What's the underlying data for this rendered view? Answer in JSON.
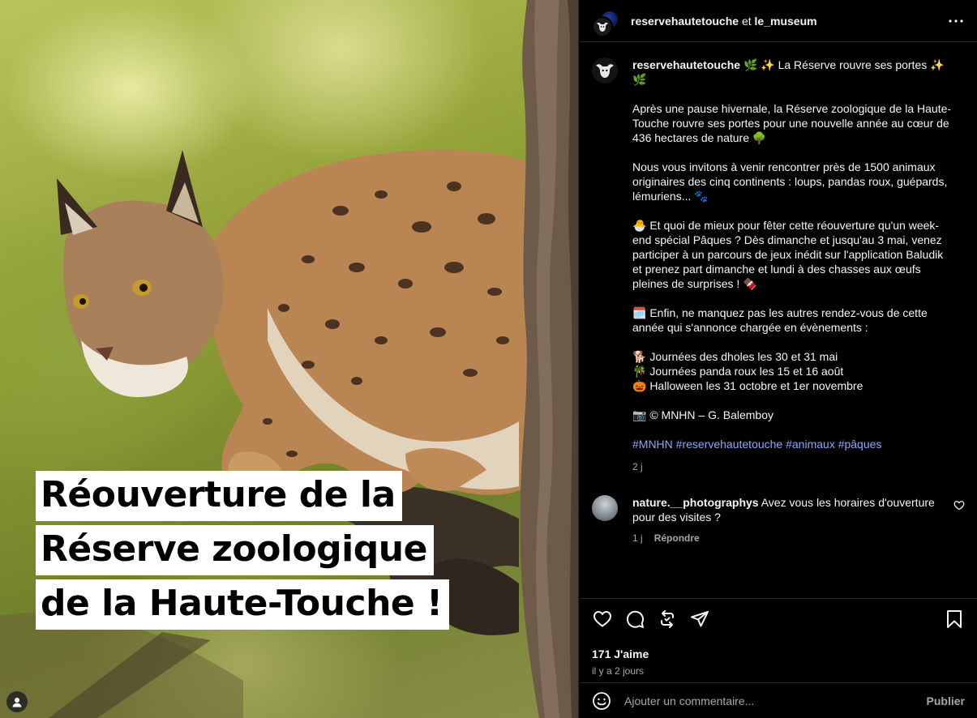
{
  "photo": {
    "caption_lines": [
      "Réouverture de la",
      "Réserve zoologique",
      "de la Haute-Touche !"
    ]
  },
  "header": {
    "account1": "reservehautetouche",
    "connector": "et",
    "account2": "le_museum"
  },
  "post": {
    "username": "reservehautetouche",
    "line0": "🌿 ✨ La Réserve rouvre ses portes ✨ 🌿",
    "para1": "Après une pause hivernale, la Réserve zoologique de la Haute-Touche rouvre ses portes pour une nouvelle année au cœur de 436 hectares de nature 🌳",
    "para2": "Nous vous invitons à venir rencontrer près de 1500 animaux originaires des cinq continents : loups, pandas roux, guépards, lémuriens... 🐾",
    "para3": "🐣 Et quoi de mieux pour fêter cette réouverture qu'un week-end spécial Pâques ? Dès dimanche et jusqu'au 3 mai, venez participer à un parcours de jeux inédit sur l'application Baludik et prenez part dimanche et lundi à des chasses aux œufs pleines de surprises ! 🍫",
    "para4": "🗓️ Enfin, ne manquez pas les autres rendez-vous de cette année qui s'annonce chargée en évènements :",
    "events": [
      "🐕 Journées des dholes les 30 et 31 mai",
      "🎋 Journées panda roux les 15 et 16 août",
      "🎃 Halloween les 31 octobre et 1er novembre"
    ],
    "credit": "📷 © MNHN – G. Balemboy",
    "hashtags": [
      "#MNHN",
      "#reservehautetouche",
      "#animaux",
      "#pâques"
    ],
    "time": "2 j"
  },
  "comment": {
    "username": "nature.__photographys",
    "text": "Avez vous les horaires d'ouverture pour des visites ?",
    "time": "1 j",
    "reply_label": "Répondre"
  },
  "actions": {
    "likes": "171 J'aime",
    "ago": "il y a 2 jours",
    "icons": [
      "heart-icon",
      "comment-icon",
      "repost-icon",
      "share-icon",
      "bookmark-icon"
    ]
  },
  "add_comment": {
    "placeholder": "Ajouter un commentaire...",
    "publish_label": "Publier"
  },
  "colors": {
    "hashtag": "#8ea7ff",
    "muted": "#a8a8a8",
    "border": "#262626"
  }
}
